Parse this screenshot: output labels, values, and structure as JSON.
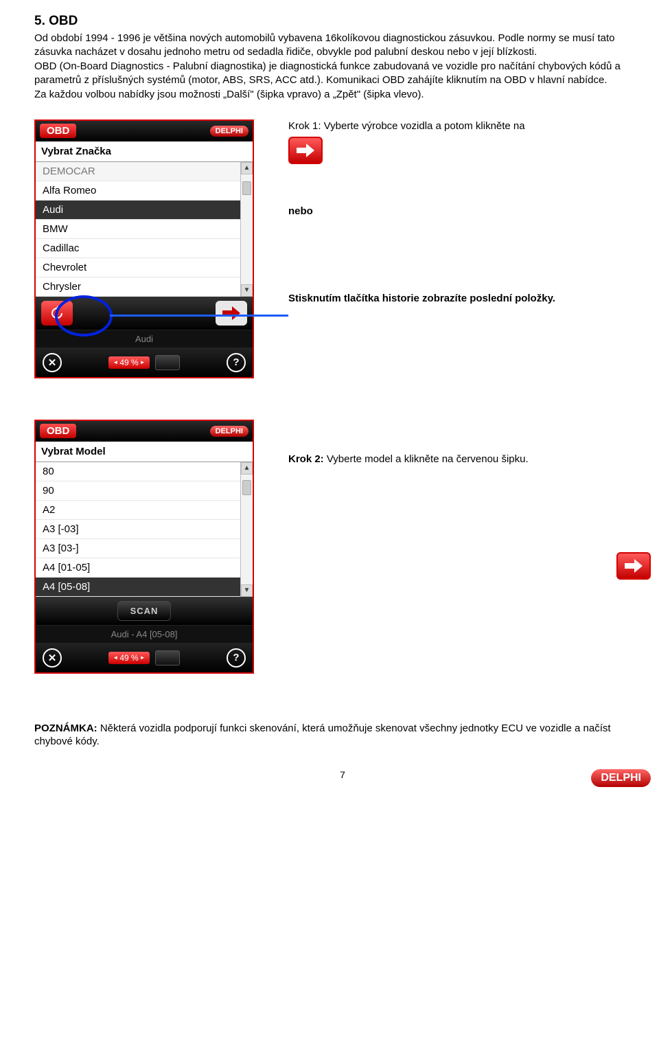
{
  "heading": "5. OBD",
  "para1": "Od období 1994 - 1996 je většina nových automobilů vybavena 16kolíkovou diagnostickou zásuvkou. Podle normy se musí tato zásuvka nacházet v dosahu jednoho metru od sedadla řidiče, obvykle pod palubní deskou nebo v její blízkosti.",
  "para2": "OBD (On-Board Diagnostics - Palubní diagnostika) je diagnostická funkce zabudovaná ve vozidle pro načítání chybových kódů a parametrů z příslušných systémů (motor, ABS, SRS, ACC atd.). Komunikaci OBD zahájíte kliknutím na OBD v hlavní nabídce.",
  "para3": "Za každou volbou nabídky jsou možnosti „Další\" (šipka vpravo) a „Zpět\" (šipka vlevo).",
  "device1": {
    "obd_label": "OBD",
    "delphi": "DELPHI",
    "subhead": "Vybrat Značka",
    "items": [
      {
        "label": "DEMOCAR",
        "cls": "demo"
      },
      {
        "label": "Alfa Romeo",
        "cls": ""
      },
      {
        "label": "Audi",
        "cls": "sel"
      },
      {
        "label": "BMW",
        "cls": ""
      },
      {
        "label": "Cadillac",
        "cls": ""
      },
      {
        "label": "Chevrolet",
        "cls": ""
      },
      {
        "label": "Chrysler",
        "cls": ""
      }
    ],
    "status": "Audi",
    "percent": "49 %"
  },
  "device2": {
    "obd_label": "OBD",
    "delphi": "DELPHI",
    "subhead": "Vybrat Model",
    "items": [
      {
        "label": "80",
        "cls": ""
      },
      {
        "label": "90",
        "cls": ""
      },
      {
        "label": "A2",
        "cls": ""
      },
      {
        "label": "A3 [-03]",
        "cls": ""
      },
      {
        "label": "A3 [03-]",
        "cls": ""
      },
      {
        "label": "A4 [01-05]",
        "cls": ""
      },
      {
        "label": "A4 [05-08]",
        "cls": "sel"
      }
    ],
    "scan": "SCAN",
    "status": "Audi - A4 [05-08]",
    "percent": "49 %"
  },
  "text": {
    "krok1": "Krok 1: Vyberte výrobce vozidla a potom klikněte na",
    "nebo": "nebo",
    "hist_bold": "Stisknutím tlačítka historie zobrazíte poslední položky.",
    "krok2_b": "Krok 2:",
    "krok2_rest": " Vyberte model a klikněte na červenou šipku."
  },
  "footnote_b": "POZNÁMKA:",
  "footnote_rest": " Některá vozidla podporují funkci skenování, která umožňuje skenovat všechny jednotky ECU ve vozidle a načíst chybové kódy.",
  "page_number": "7",
  "logo": "DELPHI"
}
